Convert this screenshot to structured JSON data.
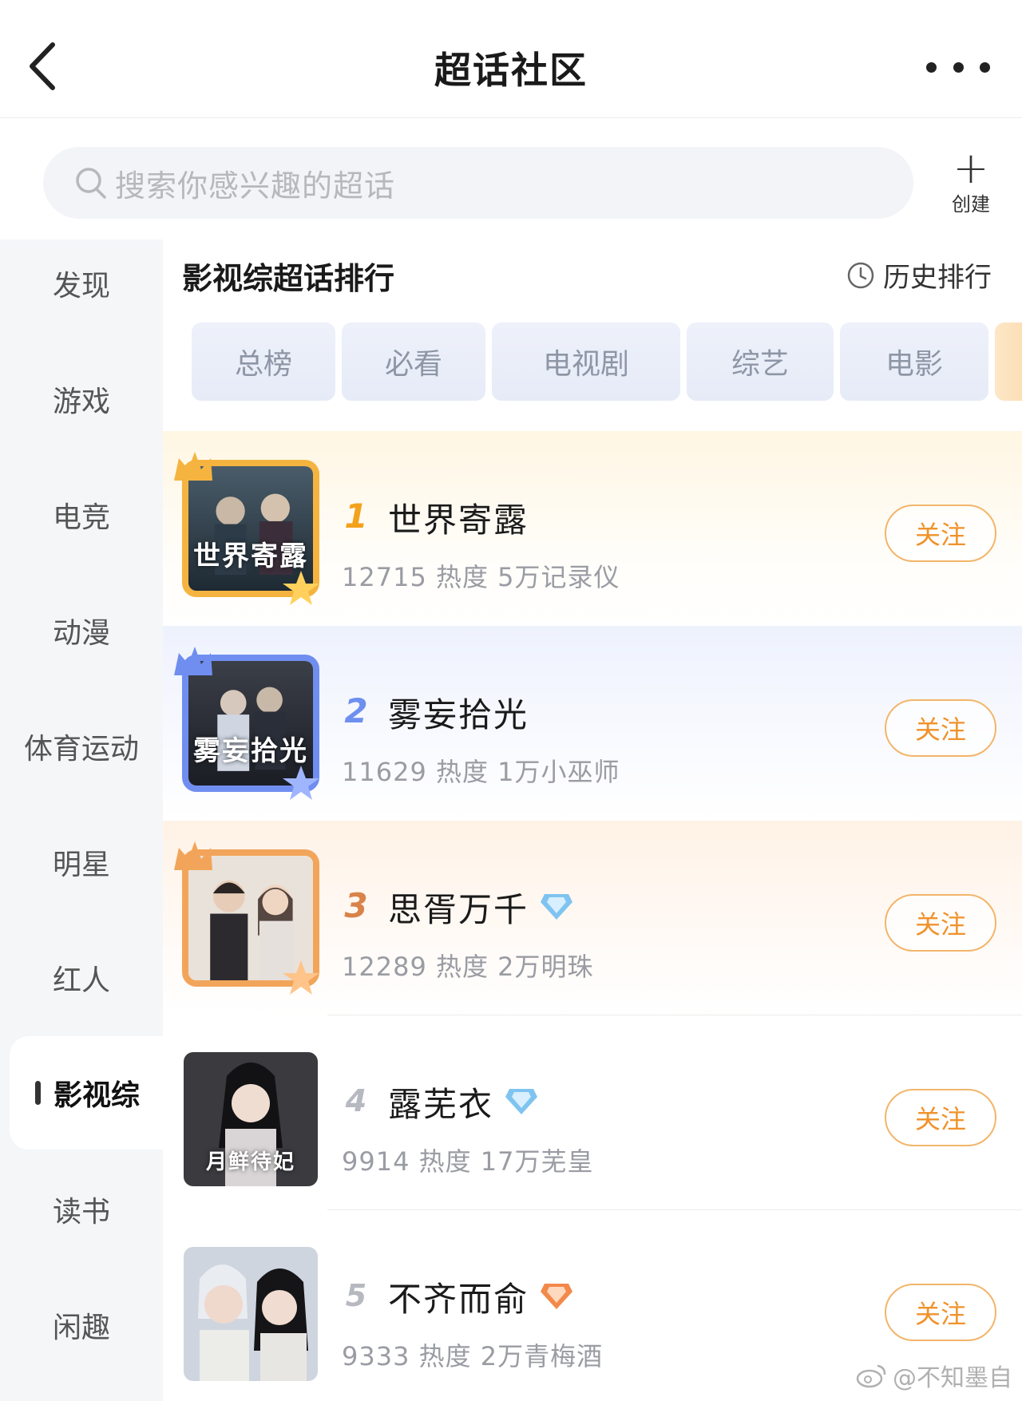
{
  "header": {
    "title": "超话社区"
  },
  "search": {
    "placeholder": "搜索你感兴趣的超话",
    "create_label": "创建",
    "create_symbol": "+"
  },
  "sidebar": {
    "items": [
      {
        "label": "发现"
      },
      {
        "label": "游戏"
      },
      {
        "label": "电竞"
      },
      {
        "label": "动漫"
      },
      {
        "label": "体育运动"
      },
      {
        "label": "明星"
      },
      {
        "label": "红人"
      },
      {
        "label": "影视综",
        "active": true
      },
      {
        "label": "读书"
      },
      {
        "label": "闲趣"
      }
    ]
  },
  "section": {
    "title": "影视综超话排行",
    "history_label": "历史排行"
  },
  "tabs": [
    {
      "label": "总榜"
    },
    {
      "label": "必看"
    },
    {
      "label": "电视剧"
    },
    {
      "label": "综艺"
    },
    {
      "label": "电影"
    }
  ],
  "ranking": [
    {
      "rank": "1",
      "name": "世界寄露",
      "stats": "12715 热度  5万记录仪",
      "follow": "关注",
      "cover_text": "世界寄露",
      "badge": null
    },
    {
      "rank": "2",
      "name": "雾妄拾光",
      "stats": "11629 热度  1万小巫师",
      "follow": "关注",
      "cover_text": "雾妄拾光",
      "badge": null
    },
    {
      "rank": "3",
      "name": "思胥万千",
      "stats": "12289 热度  2万明珠",
      "follow": "关注",
      "cover_text": "",
      "badge": "blue-diamond-icon"
    },
    {
      "rank": "4",
      "name": "露芜衣",
      "stats": "9914 热度  17万芜皇",
      "follow": "关注",
      "cover_text": "月鲜待妃",
      "badge": "blue-diamond-icon"
    },
    {
      "rank": "5",
      "name": "不齐而俞",
      "stats": "9333 热度  2万青梅酒",
      "follow": "关注",
      "cover_text": "",
      "badge": "orange-diamond-icon"
    }
  ],
  "watermark": {
    "text": "@不知墨自"
  },
  "colors": {
    "accent": "#f0922a",
    "gold": "#f3a21c",
    "silver": "#6d8ff0",
    "bronze": "#d9834a"
  }
}
